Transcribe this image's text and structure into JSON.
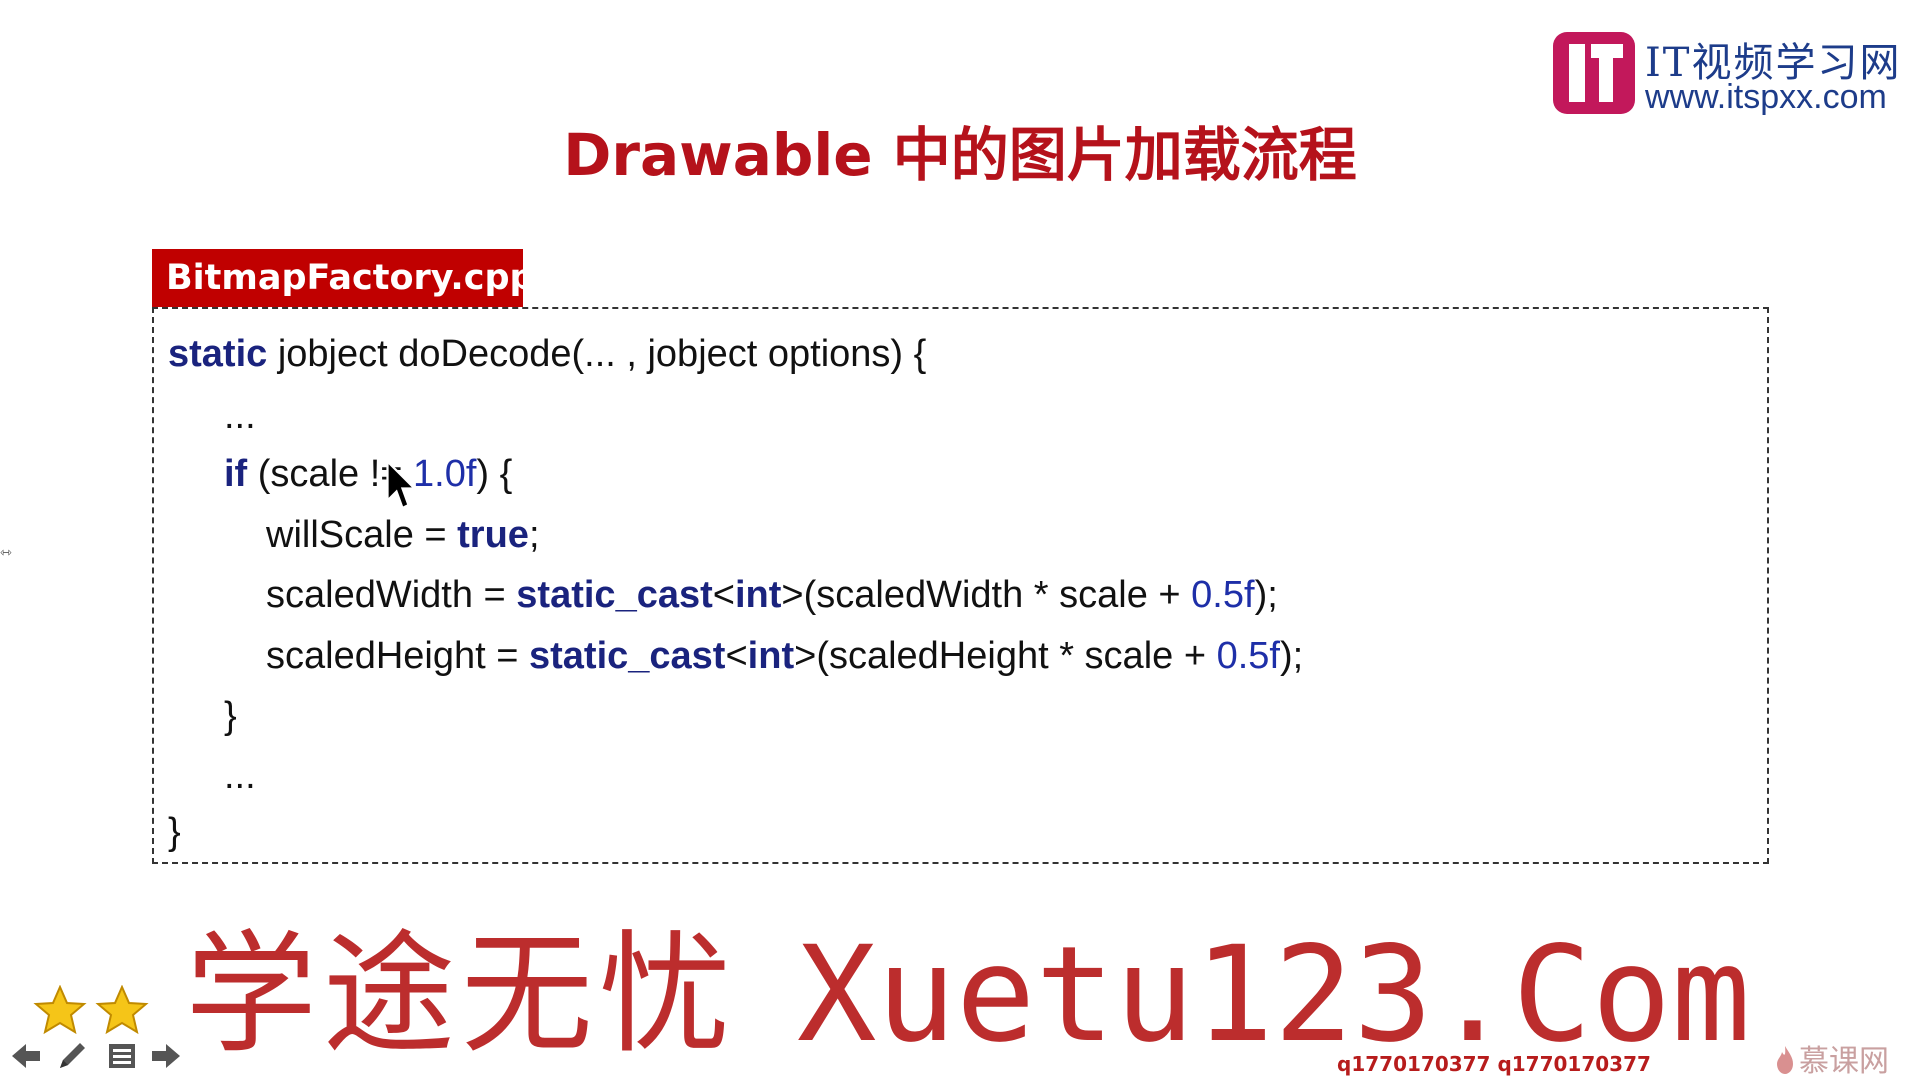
{
  "logo": {
    "title": "IT视频学习网",
    "url": "www.itspxx.com",
    "brand_color": "#c2185b"
  },
  "slide": {
    "title": "Drawable 中的图片加载流程",
    "title_color": "#b5121b",
    "file_tab": "BitmapFactory.cpp",
    "file_tab_color": "#c00000"
  },
  "code": {
    "line1": {
      "kw": "static",
      "rest": " jobject doDecode(... , jobject options) {"
    },
    "line2": "...",
    "line3": {
      "kw": "if",
      "a": " (scale != ",
      "num": "1.0f",
      "b": ") {"
    },
    "line4": {
      "a": "willScale = ",
      "kw": "true",
      "b": ";"
    },
    "line5": {
      "a": "scaledWidth = ",
      "kw1": "static_cast",
      "lt": "<",
      "kw2": "int",
      "gt": ">",
      "b": "(scaledWidth * scale + ",
      "num": "0.5f",
      "c": ");"
    },
    "line6": {
      "a": "scaledHeight = ",
      "kw1": "static_cast",
      "lt": "<",
      "kw2": "int",
      "gt": ">",
      "b": "(scaledHeight * scale + ",
      "num": "0.5f",
      "c": ");"
    },
    "line7": "}",
    "line8": "...",
    "line9": "}",
    "keyword_color": "#1a237e",
    "number_color": "#1e2fa8"
  },
  "watermark": {
    "cn": "学途无忧",
    "en": "Xuetu123.Com",
    "qq": "q1770170377 q1770170377",
    "site": "慕课网",
    "color": "#b71c1c"
  },
  "controls": {
    "icons": [
      "star-icon",
      "star-icon",
      "arrow-left-icon",
      "pen-icon",
      "menu-icon",
      "arrow-right-icon"
    ]
  }
}
